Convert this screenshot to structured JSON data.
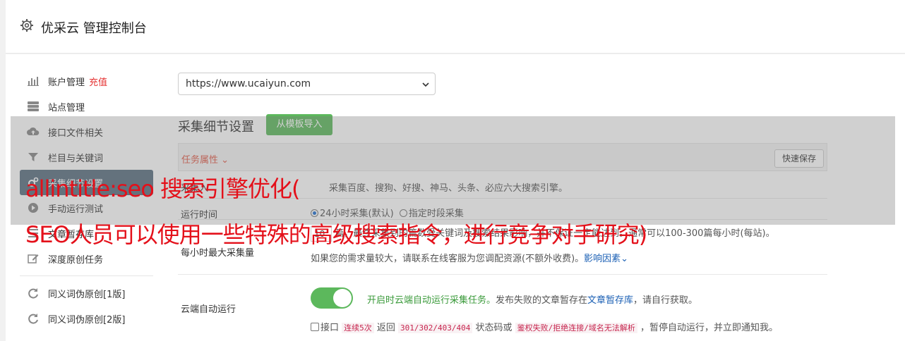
{
  "header": {
    "title": "优采云 管理控制台",
    "icon": "gear-icon"
  },
  "sidebar": {
    "items": [
      {
        "label": "账户管理",
        "extra": "充值",
        "icon": "bar-chart-icon"
      },
      {
        "label": "站点管理",
        "icon": "server-icon"
      },
      {
        "label": "接口文件相关",
        "icon": "cloud-upload-icon"
      },
      {
        "label": "栏目与关键词",
        "icon": "filter-icon"
      },
      {
        "label": "采集细节设置",
        "icon": "gears-icon",
        "active": true
      },
      {
        "label": "手动运行测试",
        "icon": "play-circle-icon"
      },
      {
        "label": "文章暂存库",
        "icon": "list-icon"
      },
      {
        "label": "深度原创任务",
        "icon": "edit-icon"
      },
      {
        "label": "同义词伪原创[1版]",
        "icon": "refresh-icon"
      },
      {
        "label": "同义词伪原创[2版]",
        "icon": "refresh-icon"
      }
    ]
  },
  "site_select": {
    "value": "https://www.ucaiyun.com"
  },
  "section": {
    "title": "采集细节设置",
    "template_button": "从模板导入"
  },
  "task_bar": {
    "label": "任务属性 ",
    "save_button": "快速保存"
  },
  "rows": {
    "r1": {
      "label": "采集入",
      "value": "采集百度、搜狗、好搜、神马、头条、必应六大搜索引擎。"
    },
    "r2": {
      "label": "运行时间",
      "opt1": "24小时采集(默认)",
      "opt2": "指定时段采集"
    },
    "r3": {
      "label": "每小时最大采集量",
      "input": "10",
      "line1": "篇，最终采集到的篇数受关键词及搜索结果影响，并不保证一定能达到。通常可以100-300篇每小时(每站)。",
      "line2": "如果您的需求量较大，请联系在线客服为您调配资源(不额外收费)。",
      "link": "影响因素"
    },
    "r4": {
      "label": "云端自动运行",
      "enabled_text": "开启时云端自动运行采集任务。",
      "desc1": "发布失败的文章暂存在",
      "link": "文章暂存库",
      "desc2": "，请自行获取。",
      "chk_label": "接口",
      "code1": "连续5次",
      "mid1": " 返回 ",
      "code2": "301/302/403/404",
      "mid2": " 状态码或 ",
      "code3": "鉴权失败/拒绝连接/域名无法解析",
      "tail": " ，暂停自动运行，并立即通知我。"
    }
  },
  "overlay": {
    "line1": "allintitle:seo 搜索引擎优化(",
    "line2": "SEO人员可以使用一些特殊的高级搜索指令，进行竞争对手研究)"
  },
  "colors": {
    "accent_green": "#5cb85c",
    "active_bg": "#5a6f80",
    "overlay_text": "#e4101a"
  }
}
